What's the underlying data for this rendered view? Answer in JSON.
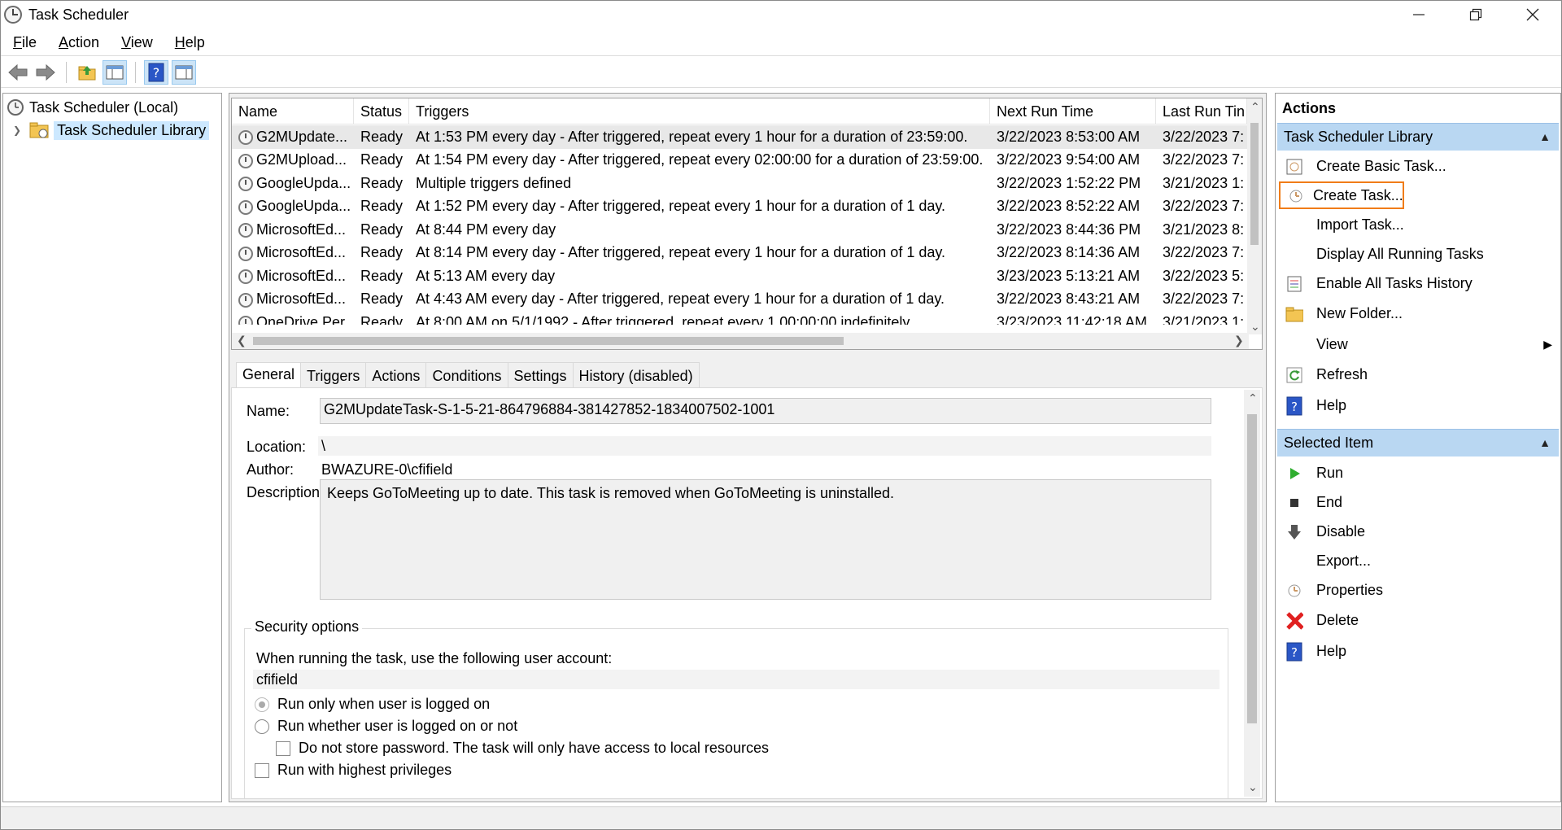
{
  "window": {
    "title": "Task Scheduler"
  },
  "menu": [
    {
      "label": "File",
      "accel": "F",
      "rest": "ile"
    },
    {
      "label": "Action",
      "accel": "A",
      "rest": "ction"
    },
    {
      "label": "View",
      "accel": "V",
      "rest": "iew"
    },
    {
      "label": "Help",
      "accel": "H",
      "rest": "elp"
    }
  ],
  "toolbar": {
    "icons": [
      "back-arrow-icon",
      "forward-arrow-icon",
      "up-folder-icon",
      "show-hide-console-tree-icon",
      "help-icon",
      "show-hide-action-pane-icon"
    ]
  },
  "tree": {
    "root": "Task Scheduler (Local)",
    "library": "Task Scheduler Library"
  },
  "grid": {
    "columns": [
      "Name",
      "Status",
      "Triggers",
      "Next Run Time",
      "Last Run Tin"
    ],
    "rows": [
      {
        "name": "G2MUpdate...",
        "status": "Ready",
        "triggers": "At 1:53 PM every day - After triggered, repeat every 1 hour for a duration of 23:59:00.",
        "next": "3/22/2023 8:53:00 AM",
        "last": "3/22/2023 7:"
      },
      {
        "name": "G2MUpload...",
        "status": "Ready",
        "triggers": "At 1:54 PM every day - After triggered, repeat every 02:00:00 for a duration of 23:59:00.",
        "next": "3/22/2023 9:54:00 AM",
        "last": "3/22/2023 7:"
      },
      {
        "name": "GoogleUpda...",
        "status": "Ready",
        "triggers": "Multiple triggers defined",
        "next": "3/22/2023 1:52:22 PM",
        "last": "3/21/2023 1:"
      },
      {
        "name": "GoogleUpda...",
        "status": "Ready",
        "triggers": "At 1:52 PM every day - After triggered, repeat every 1 hour for a duration of 1 day.",
        "next": "3/22/2023 8:52:22 AM",
        "last": "3/22/2023 7:"
      },
      {
        "name": "MicrosoftEd...",
        "status": "Ready",
        "triggers": "At 8:44 PM every day",
        "next": "3/22/2023 8:44:36 PM",
        "last": "3/21/2023 8:"
      },
      {
        "name": "MicrosoftEd...",
        "status": "Ready",
        "triggers": "At 8:14 PM every day - After triggered, repeat every 1 hour for a duration of 1 day.",
        "next": "3/22/2023 8:14:36 AM",
        "last": "3/22/2023 7:"
      },
      {
        "name": "MicrosoftEd...",
        "status": "Ready",
        "triggers": "At 5:13 AM every day",
        "next": "3/23/2023 5:13:21 AM",
        "last": "3/22/2023 5:"
      },
      {
        "name": "MicrosoftEd...",
        "status": "Ready",
        "triggers": "At 4:43 AM every day - After triggered, repeat every 1 hour for a duration of 1 day.",
        "next": "3/22/2023 8:43:21 AM",
        "last": "3/22/2023 7:"
      },
      {
        "name": "OneDrive Per...",
        "status": "Ready",
        "triggers": "At 8:00 AM on 5/1/1992 - After triggered, repeat every 1.00:00:00 indefinitely.",
        "next": "3/23/2023 11:42:18 AM",
        "last": "3/21/2023 1:"
      }
    ]
  },
  "tabs": [
    "General",
    "Triggers",
    "Actions",
    "Conditions",
    "Settings",
    "History (disabled)"
  ],
  "general": {
    "name_label": "Name:",
    "name_value": "G2MUpdateTask-S-1-5-21-864796884-381427852-1834007502-1001",
    "location_label": "Location:",
    "location_value": "\\",
    "author_label": "Author:",
    "author_value": "BWAZURE-0\\cfifield",
    "description_label": "Description:",
    "description_value": "Keeps GoToMeeting up to date. This task is removed when GoToMeeting is uninstalled.",
    "security_title": "Security options",
    "security_prompt": "When running the task, use the following user account:",
    "account": "cfifield",
    "radio_logged_on": "Run only when user is logged on",
    "radio_whether": "Run whether user is logged on or not",
    "check_no_store": "Do not store password.  The task will only have access to local resources",
    "check_highest": "Run with highest privileges"
  },
  "actions": {
    "title": "Actions",
    "library_section": "Task Scheduler Library",
    "library_items": [
      {
        "label": "Create Basic Task...",
        "icon": "create-basic-task-icon"
      },
      {
        "label": "Create Task...",
        "icon": "create-task-icon"
      },
      {
        "label": "Import Task...",
        "icon": "none"
      },
      {
        "label": "Display All Running Tasks",
        "icon": "running-tasks-icon"
      },
      {
        "label": "Enable All Tasks History",
        "icon": "tasks-history-icon"
      },
      {
        "label": "New Folder...",
        "icon": "new-folder-icon"
      },
      {
        "label": "View",
        "icon": "none"
      },
      {
        "label": "Refresh",
        "icon": "refresh-icon"
      },
      {
        "label": "Help",
        "icon": "help-icon"
      }
    ],
    "selected_section": "Selected Item",
    "selected_items": [
      {
        "label": "Run",
        "icon": "run-icon"
      },
      {
        "label": "End",
        "icon": "end-icon"
      },
      {
        "label": "Disable",
        "icon": "disable-icon"
      },
      {
        "label": "Export...",
        "icon": "none"
      },
      {
        "label": "Properties",
        "icon": "properties-icon"
      },
      {
        "label": "Delete",
        "icon": "delete-icon"
      },
      {
        "label": "Help",
        "icon": "help-icon"
      }
    ]
  },
  "colors": {
    "section_header": "#b9d7f2",
    "highlight": "#f07c18",
    "selection": "#cce8ff"
  }
}
